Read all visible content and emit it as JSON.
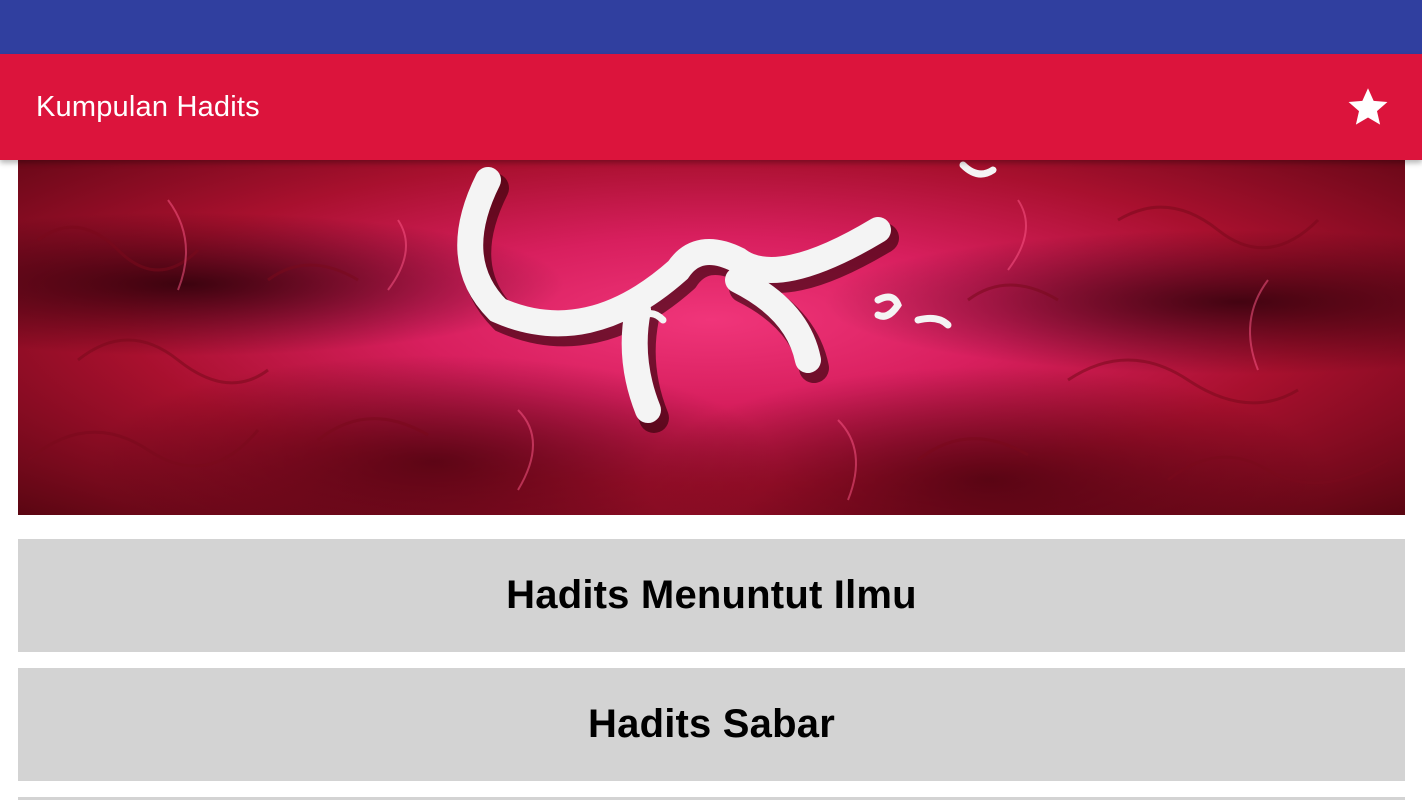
{
  "status_bar": {
    "color": "#303f9f"
  },
  "app_bar": {
    "title": "Kumpulan Hadits",
    "color": "#dc143c",
    "action_icon": "star-icon"
  },
  "banner": {
    "description_icon": "calligraphy-banner-image",
    "colors": [
      "#f0357a",
      "#a8102e",
      "#5a0612"
    ]
  },
  "menu": {
    "items": [
      {
        "label": "Hadits Menuntut Ilmu"
      },
      {
        "label": "Hadits Sabar"
      },
      {
        "label": ""
      }
    ],
    "item_background": "#d3d3d3"
  }
}
